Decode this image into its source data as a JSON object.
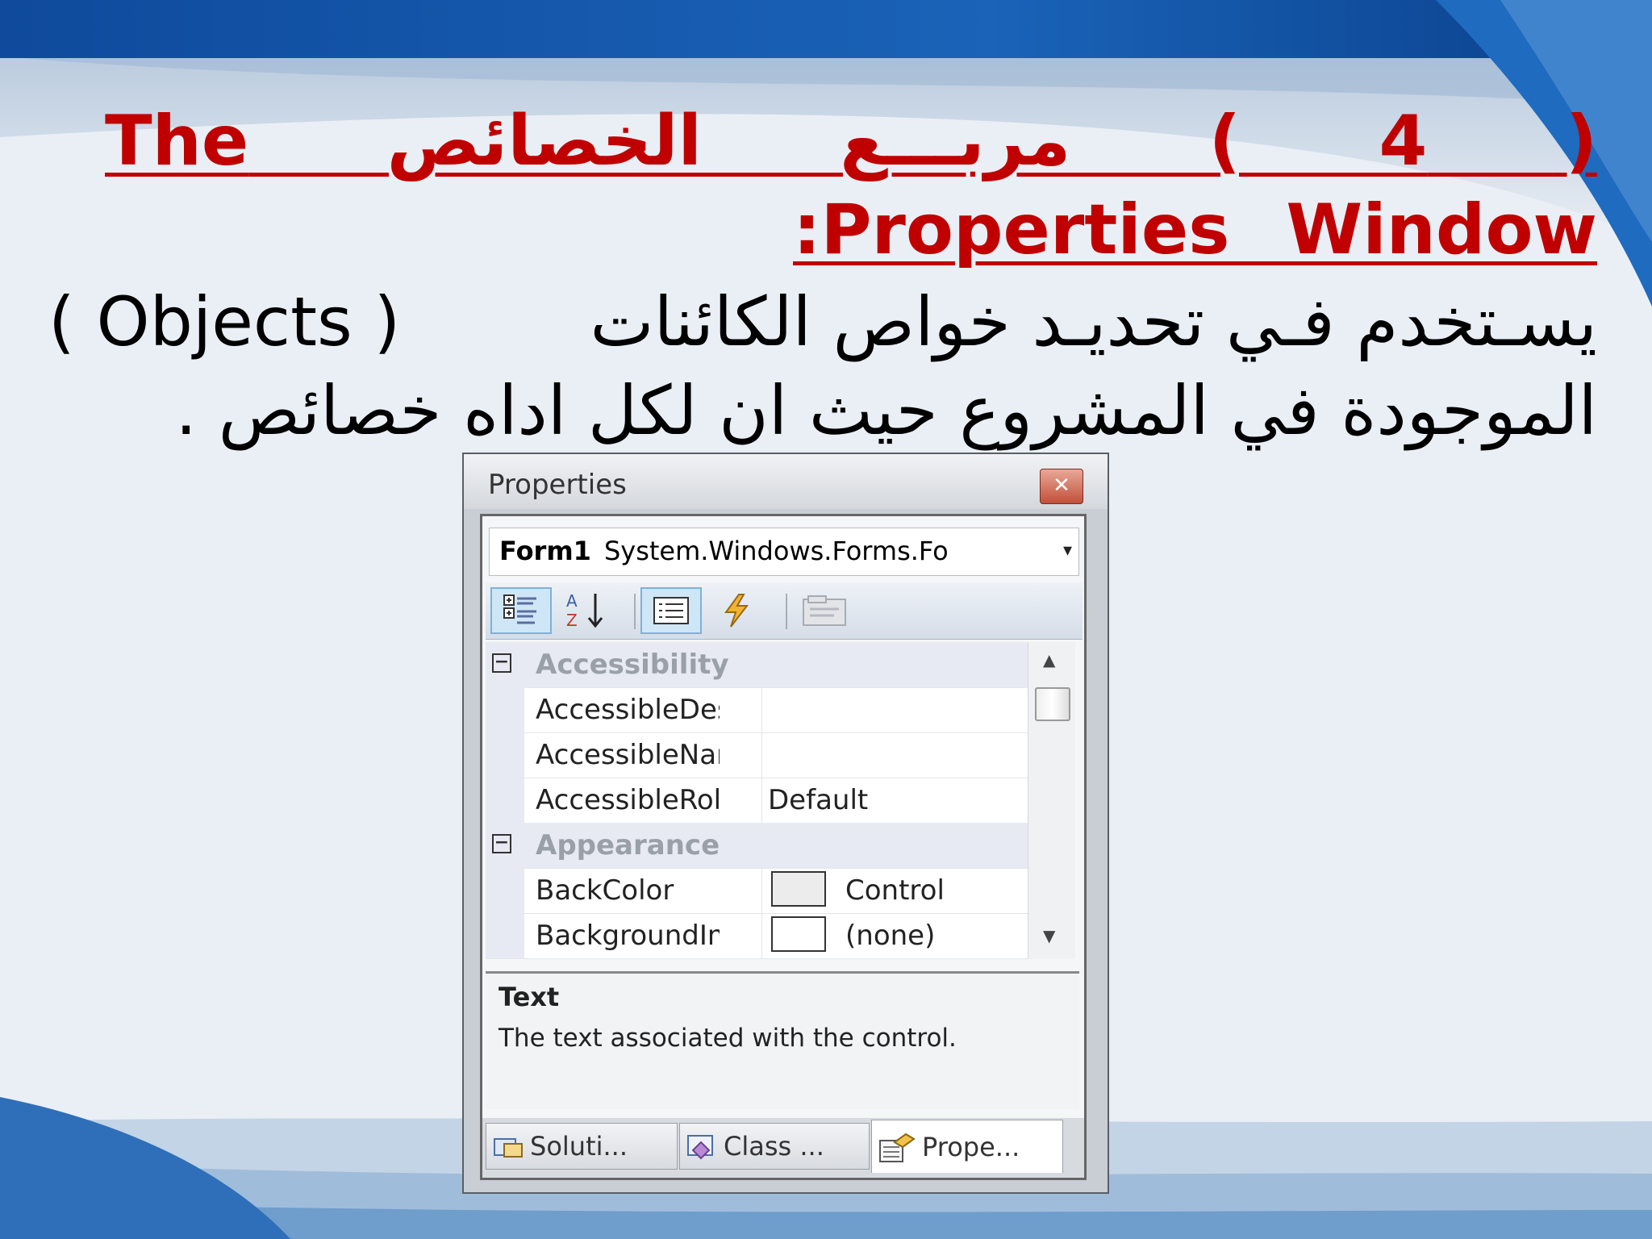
{
  "slide": {
    "title": "( 4 ) مربـــع الخصائص The Properties Window:",
    "body_line1_arabic": "يسـتخدم فـي تحديـد خواص الكائنات",
    "body_line1_latin": "( Objects )",
    "body_line2": "الموجودة في المشروع حيث ان لكل اداه خصائص ."
  },
  "properties_window": {
    "title": "Properties",
    "close_glyph": "✕",
    "object_selector": {
      "name": "Form1",
      "type": "System.Windows.Forms.Fo",
      "dropdown_glyph": "▾"
    },
    "toolbar": {
      "buttons": [
        "categorized-icon",
        "alphabetical-icon",
        "properties-icon",
        "events-icon",
        "property-pages-icon"
      ],
      "alpha_label": "A Z"
    },
    "grid": {
      "categories": [
        {
          "name": "Accessibility",
          "expand_glyph": "−",
          "rows": [
            {
              "name": "AccessibleDesc",
              "value": ""
            },
            {
              "name": "AccessibleNam",
              "value": ""
            },
            {
              "name": "AccessibleRole",
              "value": "Default"
            }
          ]
        },
        {
          "name": "Appearance",
          "expand_glyph": "−",
          "rows": [
            {
              "name": "BackColor",
              "value": "Control",
              "swatch": "#ececec"
            },
            {
              "name": "BackgroundIm",
              "value": "(none)",
              "swatch": "#ffffff"
            }
          ]
        }
      ],
      "scroll_up": "▲",
      "scroll_down": "▼"
    },
    "description": {
      "title": "Text",
      "body": "The text associated with the control."
    },
    "tabs": [
      {
        "label": "Soluti...",
        "icon": "solution-explorer-icon",
        "active": false
      },
      {
        "label": "Class ...",
        "icon": "class-view-icon",
        "active": false
      },
      {
        "label": "Prope...",
        "icon": "properties-tab-icon",
        "active": true
      }
    ]
  },
  "colors": {
    "title_red": "#c00000",
    "header_blue": "#1f5fb0"
  }
}
